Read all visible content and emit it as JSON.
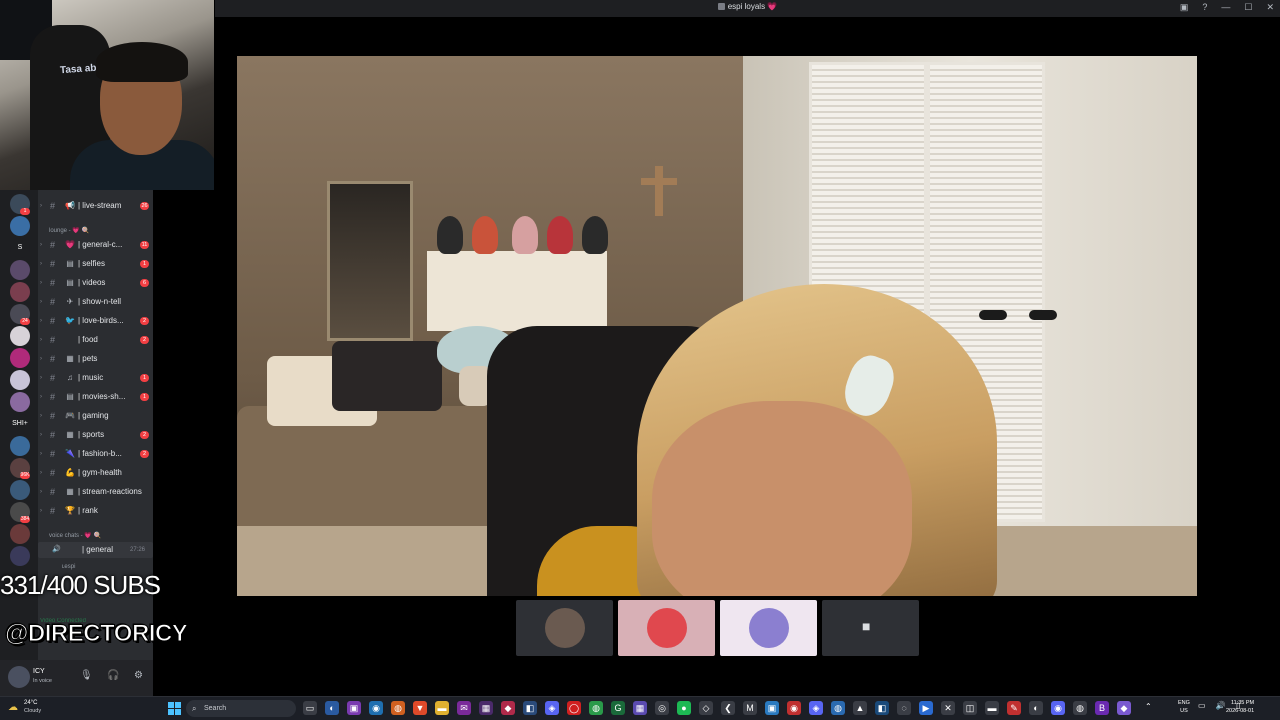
{
  "window": {
    "title": "espi loyals 💗",
    "controls": [
      "▣",
      "?",
      "—",
      "☐",
      "✕"
    ]
  },
  "webcam": {
    "chair_text": "Tasa ab"
  },
  "server_rail": {
    "items": [
      {
        "label": "",
        "color": "#3b4a5a",
        "badge": "1"
      },
      {
        "label": "",
        "color": "#3a6ea5",
        "badge": ""
      },
      {
        "label": "S",
        "color": "#1e1f22",
        "badge": ""
      },
      {
        "label": "",
        "color": "#5a4a6a",
        "badge": ""
      },
      {
        "label": "",
        "color": "#7a3e4e",
        "badge": ""
      },
      {
        "label": "",
        "color": "#4a4a55",
        "badge": "24"
      },
      {
        "label": "",
        "color": "#d7d2d8",
        "badge": ""
      },
      {
        "label": "",
        "color": "#b02a7a",
        "badge": ""
      },
      {
        "label": "",
        "color": "#c8c4d8",
        "badge": ""
      },
      {
        "label": "",
        "color": "#8a6aa0",
        "badge": ""
      },
      {
        "label": "SHI+",
        "color": "#1e1f22",
        "badge": ""
      },
      {
        "label": "",
        "color": "#3a6a9a",
        "badge": ""
      },
      {
        "label": "",
        "color": "#5a4040",
        "badge": "96K"
      },
      {
        "label": "",
        "color": "#3a5a7a",
        "badge": ""
      },
      {
        "label": "",
        "color": "#4a4a4a",
        "badge": "384"
      },
      {
        "label": "",
        "color": "#6a3a3a",
        "badge": ""
      },
      {
        "label": "",
        "color": "#3a3a5a",
        "badge": ""
      }
    ]
  },
  "sidebar": {
    "channels_top": [
      {
        "emoji": "📢",
        "name": "| live-stream",
        "badge": "26"
      }
    ],
    "lounge_category": "lounge - 💗 🍭",
    "channels": [
      {
        "emoji": "💗",
        "name": "| general-c...",
        "badge": "11"
      },
      {
        "emoji": "▤",
        "name": "| selfies",
        "badge": "1"
      },
      {
        "emoji": "▤",
        "name": "| videos",
        "badge": "6"
      },
      {
        "emoji": "✈",
        "name": "| show-n-tell",
        "badge": ""
      },
      {
        "emoji": "🐦",
        "name": "| love-birds...",
        "badge": "2"
      },
      {
        "emoji": "",
        "name": "| food",
        "badge": "2"
      },
      {
        "emoji": "▦",
        "name": "| pets",
        "badge": ""
      },
      {
        "emoji": "♫",
        "name": "| music",
        "badge": "1"
      },
      {
        "emoji": "▤",
        "name": "| movies-sh...",
        "badge": "1"
      },
      {
        "emoji": "🎮",
        "name": "| gaming",
        "badge": ""
      },
      {
        "emoji": "▦",
        "name": "| sports",
        "badge": "2"
      },
      {
        "emoji": "🌂",
        "name": "| fashion-b...",
        "badge": "2"
      },
      {
        "emoji": "💪",
        "name": "| gym-health",
        "badge": ""
      },
      {
        "emoji": "▦",
        "name": "| stream-reactions",
        "badge": ""
      },
      {
        "emoji": "🏆",
        "name": "| rank",
        "badge": ""
      }
    ],
    "voice_category": "voice chats - 💗 🍭",
    "voice_channel": {
      "name": "| general",
      "timer": "27:26"
    },
    "voice_user": "ʟespi"
  },
  "overlay": {
    "subs": "331/400 SUBS",
    "handle": "@DIRECTORICY",
    "voice_connected": "Video Connected"
  },
  "user_panel": {
    "name": "ICY",
    "status": "In voice",
    "controls": [
      "🎙",
      "🎧",
      "⚙"
    ]
  },
  "tiles": [
    {
      "color": "#2e3035",
      "border": "#2e3035",
      "avatar": "#6a5a50"
    },
    {
      "color": "#d8b0b6",
      "border": "#d8b0b6",
      "avatar": "#e0484e"
    },
    {
      "color": "#efe6f0",
      "border": "#efe6f0",
      "avatar": "#8b7fd0"
    },
    {
      "color": "#2e3035",
      "border": "#2e3035",
      "avatar": ""
    }
  ],
  "camera_off_icon": "■",
  "taskbar": {
    "weather_temp": "24°C",
    "weather_desc": "Cloudy",
    "search_label": "Search",
    "apps": [
      {
        "glyph": "▭",
        "color": "#3a3d45"
      },
      {
        "glyph": "◐",
        "color": "#2a5aa0"
      },
      {
        "glyph": "▣",
        "color": "#7a3ab0"
      },
      {
        "glyph": "◉",
        "color": "#1f6fb0"
      },
      {
        "glyph": "◍",
        "color": "#d06020"
      },
      {
        "glyph": "▼",
        "color": "#e04a2a"
      },
      {
        "glyph": "▬",
        "color": "#e0b030"
      },
      {
        "glyph": "✉",
        "color": "#7a2a9a"
      },
      {
        "glyph": "▦",
        "color": "#4a2a6a"
      },
      {
        "glyph": "◆",
        "color": "#b02a4a"
      },
      {
        "glyph": "◧",
        "color": "#2a4a7a"
      },
      {
        "glyph": "◈",
        "color": "#5865f2"
      },
      {
        "glyph": "◯",
        "color": "#d02020"
      },
      {
        "glyph": "◍",
        "color": "#2a9a4a"
      },
      {
        "glyph": "G",
        "color": "#1a6a3a"
      },
      {
        "glyph": "▦",
        "color": "#5a4ab0"
      },
      {
        "glyph": "◎",
        "color": "#3a3d45"
      },
      {
        "glyph": "●",
        "color": "#1db954"
      },
      {
        "glyph": "◇",
        "color": "#3a3d45"
      },
      {
        "glyph": "❮",
        "color": "#3a3d45"
      },
      {
        "glyph": "M",
        "color": "#3a3d45"
      },
      {
        "glyph": "▣",
        "color": "#2a7ac0"
      },
      {
        "glyph": "◉",
        "color": "#c03030"
      },
      {
        "glyph": "◈",
        "color": "#5865f2"
      },
      {
        "glyph": "◍",
        "color": "#2a6ab0"
      },
      {
        "glyph": "▲",
        "color": "#3a3d45"
      },
      {
        "glyph": "◧",
        "color": "#1a4a7a"
      },
      {
        "glyph": "◌",
        "color": "#3a3d45"
      },
      {
        "glyph": "▶",
        "color": "#2a6ad0"
      },
      {
        "glyph": "✕",
        "color": "#3a3d45"
      },
      {
        "glyph": "◫",
        "color": "#3a3d45"
      },
      {
        "glyph": "▬",
        "color": "#3a3d45"
      },
      {
        "glyph": "✎",
        "color": "#c03030"
      },
      {
        "glyph": "◐",
        "color": "#3a3d45"
      },
      {
        "glyph": "◉",
        "color": "#5865f2"
      },
      {
        "glyph": "◍",
        "color": "#3a3d45"
      },
      {
        "glyph": "B",
        "color": "#6a2ab0"
      },
      {
        "glyph": "◆",
        "color": "#7a5ad0"
      }
    ],
    "tray_up": "⌃",
    "lang_top": "ENG",
    "lang_bottom": "US",
    "tray_icons": "▭ 🔊 ▯",
    "time": "11:35 PM",
    "date": "2026-08-01"
  }
}
